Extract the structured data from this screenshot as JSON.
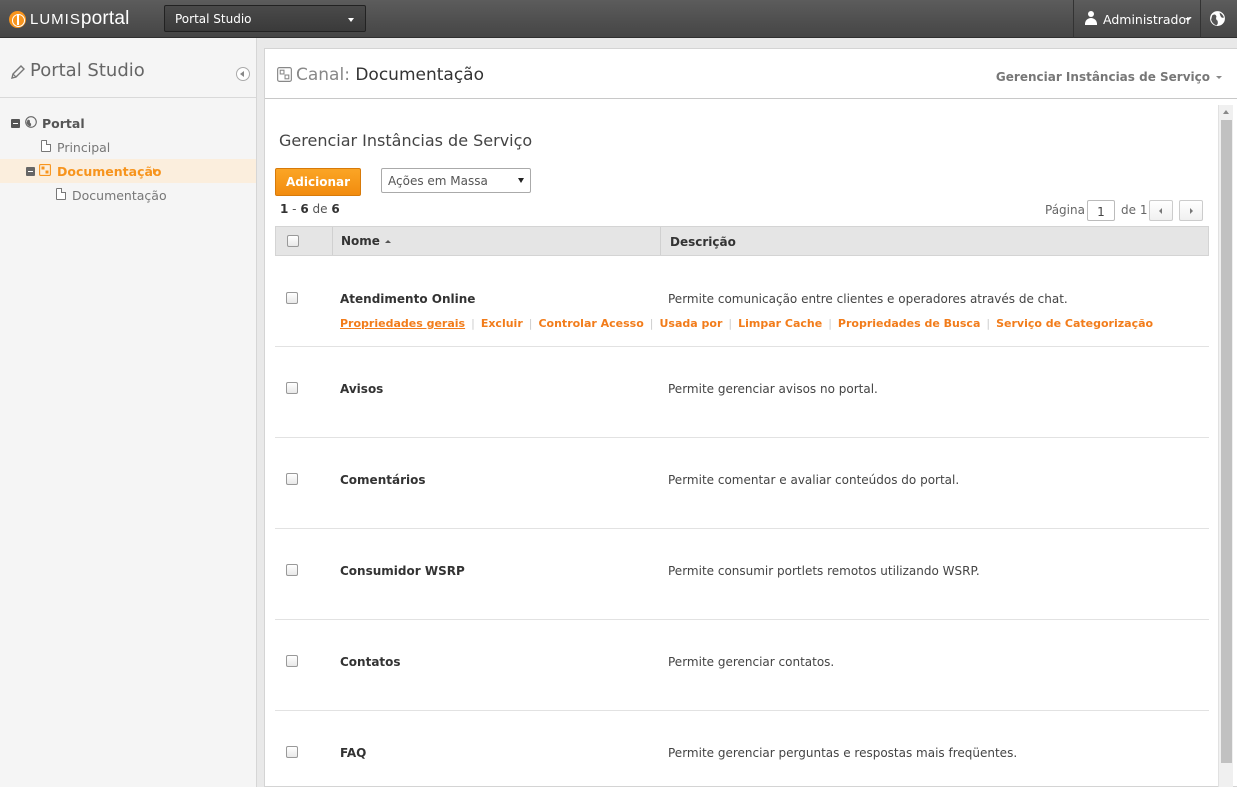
{
  "topbar": {
    "brand_prefix": "LUMIS",
    "brand_suffix": "portal",
    "site_select": "Portal Studio",
    "user": "Administrador"
  },
  "sidebar": {
    "title": "Portal Studio",
    "tree": [
      {
        "label": "Portal",
        "level": 0
      },
      {
        "label": "Principal",
        "level": 1
      },
      {
        "label": "Documentação",
        "level": 0,
        "active": true
      },
      {
        "label": "Documentação",
        "level": 2
      }
    ]
  },
  "header": {
    "prefix": "Canal:",
    "title": "Documentação",
    "menu": "Gerenciar Instâncias de Serviço"
  },
  "content": {
    "title": "Gerenciar Instâncias de Serviço",
    "add_button": "Adicionar",
    "bulk_actions": "Ações em Massa",
    "count_start": "1",
    "count_end": "6",
    "count_of": "de",
    "count_total": "6",
    "page_label": "Página",
    "page_value": "1",
    "page_of": "de 1",
    "col_name": "Nome",
    "col_desc": "Descrição",
    "row_actions": [
      "Propriedades gerais",
      "Excluir",
      "Controlar Acesso",
      "Usada por",
      "Limpar Cache",
      "Propriedades de Busca",
      "Serviço de Categorização"
    ],
    "rows": [
      {
        "name": "Atendimento Online",
        "desc": "Permite comunicação entre clientes e operadores através de chat."
      },
      {
        "name": "Avisos",
        "desc": "Permite gerenciar avisos no portal."
      },
      {
        "name": "Comentários",
        "desc": "Permite comentar e avaliar conteúdos do portal."
      },
      {
        "name": "Consumidor WSRP",
        "desc": "Permite consumir portlets remotos utilizando WSRP."
      },
      {
        "name": "Contatos",
        "desc": "Permite gerenciar contatos."
      },
      {
        "name": "FAQ",
        "desc": "Permite gerenciar perguntas e respostas mais freqüentes."
      }
    ]
  },
  "colors": {
    "accent": "#f7941d",
    "link": "#f27c1a",
    "topbar": "#4f4f4f"
  }
}
